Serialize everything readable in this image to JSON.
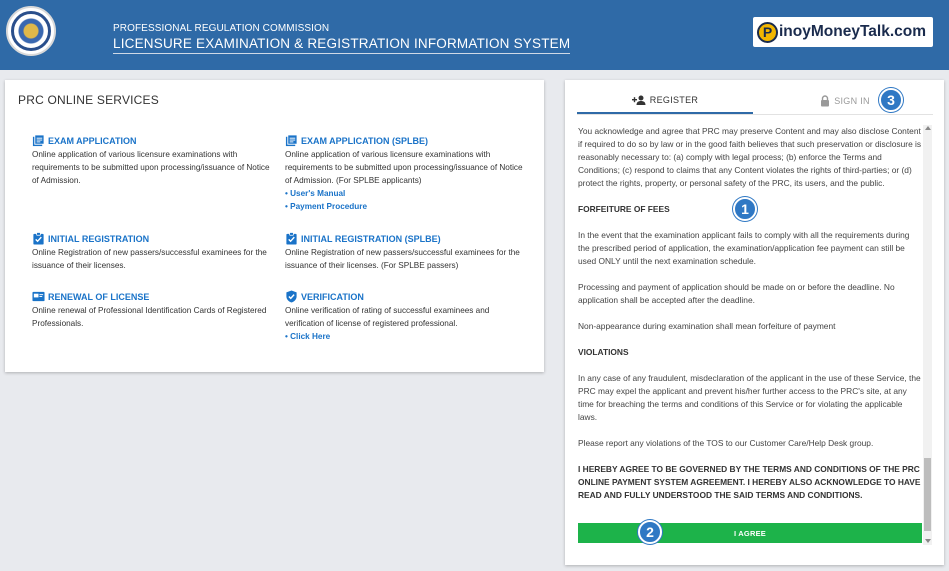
{
  "header": {
    "agency": "PROFESSIONAL REGULATION COMMISSION",
    "system": "LICENSURE EXAMINATION & REGISTRATION INFORMATION SYSTEM",
    "brand_initial": "P",
    "brand_rest": "inoyMoneyTalk.com"
  },
  "services": {
    "title": "PRC ONLINE SERVICES",
    "items": [
      {
        "title": "EXAM APPLICATION",
        "icon": "list-icon",
        "desc": "Online application of various licensure examinations with requirements to be submitted upon processing/issuance of Notice of Admission."
      },
      {
        "title": "EXAM APPLICATION (SPLBE)",
        "icon": "list-icon",
        "desc": "Online application of various licensure examinations with requirements to be submitted upon processing/issuance of Notice of Admission. (For SPLBE applicants)",
        "links": [
          "• User's Manual",
          "• Payment Procedure"
        ]
      },
      {
        "title": "INITIAL REGISTRATION",
        "icon": "clipboard-check-icon",
        "desc": "Online Registration of new passers/successful examinees for the issuance of their licenses."
      },
      {
        "title": "INITIAL REGISTRATION (SPLBE)",
        "icon": "clipboard-check-icon",
        "desc": "Online Registration of new passers/successful examinees for the issuance of their licenses. (For SPLBE passers)"
      },
      {
        "title": "RENEWAL OF LICENSE",
        "icon": "id-card-icon",
        "desc": "Online renewal of Professional Identification Cards of Registered Professionals."
      },
      {
        "title": "VERIFICATION",
        "icon": "shield-check-icon",
        "desc": "Online verification of rating of successful examinees and verification of license of registered professional.",
        "links": [
          "• Click Here"
        ]
      }
    ]
  },
  "auth": {
    "tab_register": "REGISTER",
    "tab_signin": "SIGN IN",
    "tos": {
      "p1": "You acknowledge and agree that PRC may preserve Content and may also disclose Content if required to do so by law or in the good faith believes that such preservation or disclosure is reasonably necessary to: (a) comply with legal process; (b) enforce the Terms and Conditions; (c) respond to claims that any Content violates the rights of third-parties; or (d) protect the rights, property, or personal safety of the PRC, its users, and the public.",
      "h1": "FORFEITURE OF FEES",
      "p2": "In the event that the examination applicant fails to comply with all the requirements during the prescribed period of application, the examination/application fee payment can still be used ONLY until the next examination schedule.",
      "p3": "Processing and payment of application should be made on or before the deadline. No application shall be accepted after the deadline.",
      "p4": "Non-appearance during examination shall mean forfeiture of payment",
      "h2": "VIOLATIONS",
      "p5": "In any case of any fraudulent, misdeclaration of the applicant in the use of these Service, the PRC may expel the applicant and prevent his/her further access to the PRC's site, at any time for breaching the terms and conditions of this Service or for violating the applicable laws.",
      "p6": "Please report any violations of the TOS to our Customer Care/Help Desk group.",
      "agree_statement": "I HEREBY AGREE TO BE GOVERNED BY THE TERMS AND CONDITIONS OF THE PRC ONLINE PAYMENT SYSTEM AGREEMENT. I HEREBY ALSO ACKNOWLEDGE TO HAVE READ AND FULLY UNDERSTOOD THE SAID TERMS AND CONDITIONS."
    },
    "agree_button": "I AGREE"
  },
  "markers": [
    "1",
    "2",
    "3"
  ],
  "colors": {
    "header": "#2f6aa7",
    "link": "#1a73c8",
    "agree": "#1db34a",
    "marker": "#2f78c4"
  }
}
